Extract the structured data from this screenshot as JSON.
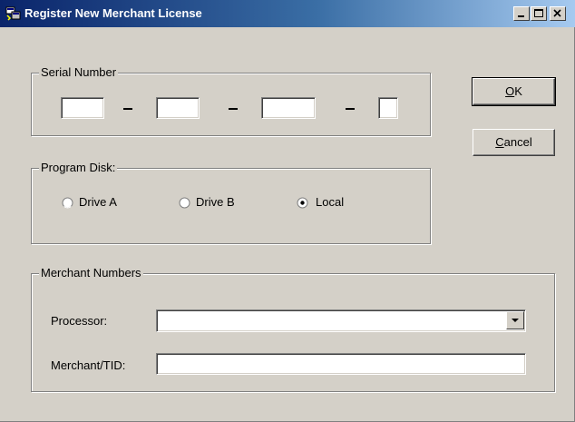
{
  "window": {
    "title": "Register New Merchant License",
    "icon": "register-app-icon",
    "controls": {
      "minimize_icon": "minimize-icon",
      "maximize_icon": "maximize-icon",
      "close_icon": "close-icon"
    }
  },
  "serial": {
    "legend": "Serial Number",
    "parts": [
      "",
      "",
      "",
      ""
    ],
    "separator": "-"
  },
  "program_disk": {
    "legend": "Program Disk:",
    "options": [
      {
        "label": "Drive A",
        "selected": false
      },
      {
        "label": "Drive B",
        "selected": false
      },
      {
        "label": "Local",
        "selected": true
      }
    ]
  },
  "merchant": {
    "legend": "Merchant Numbers",
    "processor_label": "Processor:",
    "processor_value": "",
    "tid_label": "Merchant/TID:",
    "tid_value": ""
  },
  "buttons": {
    "ok_first": "O",
    "ok_rest": "K",
    "cancel_first": "C",
    "cancel_rest": "ancel"
  },
  "colors": {
    "face": "#d4d0c8",
    "title_start": "#0a246a",
    "title_end": "#a6caf0",
    "shadow": "#808080"
  }
}
